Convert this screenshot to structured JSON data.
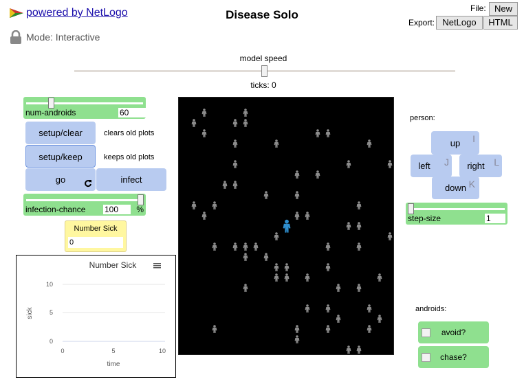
{
  "header": {
    "powered_by": "powered by NetLogo",
    "mode": "Mode: Interactive",
    "title": "Disease Solo",
    "file_label": "File:",
    "new_label": "New",
    "export_label": "Export:",
    "export_netlogo": "NetLogo",
    "export_html": "HTML"
  },
  "speed": {
    "label": "model speed",
    "ticks_text": "ticks: 0"
  },
  "controls": {
    "num_androids": {
      "label": "num-androids",
      "value": "60"
    },
    "setup_clear": "setup/clear",
    "clears_note": "clears old plots",
    "setup_keep": "setup/keep",
    "keeps_note": "keeps old plots",
    "go": "go",
    "infect": "infect",
    "infection_chance": {
      "label": "infection-chance",
      "value": "100",
      "unit": "%"
    },
    "monitor": {
      "label": "Number Sick",
      "value": "0"
    }
  },
  "plot": {
    "title": "Number Sick",
    "ylabel": "sick",
    "xlabel": "time",
    "yticks": [
      "10",
      "5",
      "0"
    ],
    "xticks": [
      "0",
      "5",
      "10"
    ]
  },
  "person": {
    "label": "person:",
    "up": "up",
    "up_key": "I",
    "left": "left",
    "left_key": "J",
    "right": "right",
    "right_key": "L",
    "down": "down",
    "down_key": "K",
    "step_size": {
      "label": "step-size",
      "value": "1"
    }
  },
  "androids": {
    "label": "androids:",
    "avoid": "avoid?",
    "chase": "chase?"
  },
  "colors": {
    "android": "#8c8c8c",
    "person": "#2f8fcf",
    "switch": "#8fe08f",
    "button": "#b8cbf0",
    "monitor": "#fff7a0"
  },
  "chart_data": {
    "type": "line",
    "title": "Number Sick",
    "xlabel": "time",
    "ylabel": "sick",
    "xlim": [
      0,
      10
    ],
    "ylim": [
      0,
      10
    ],
    "series": []
  }
}
